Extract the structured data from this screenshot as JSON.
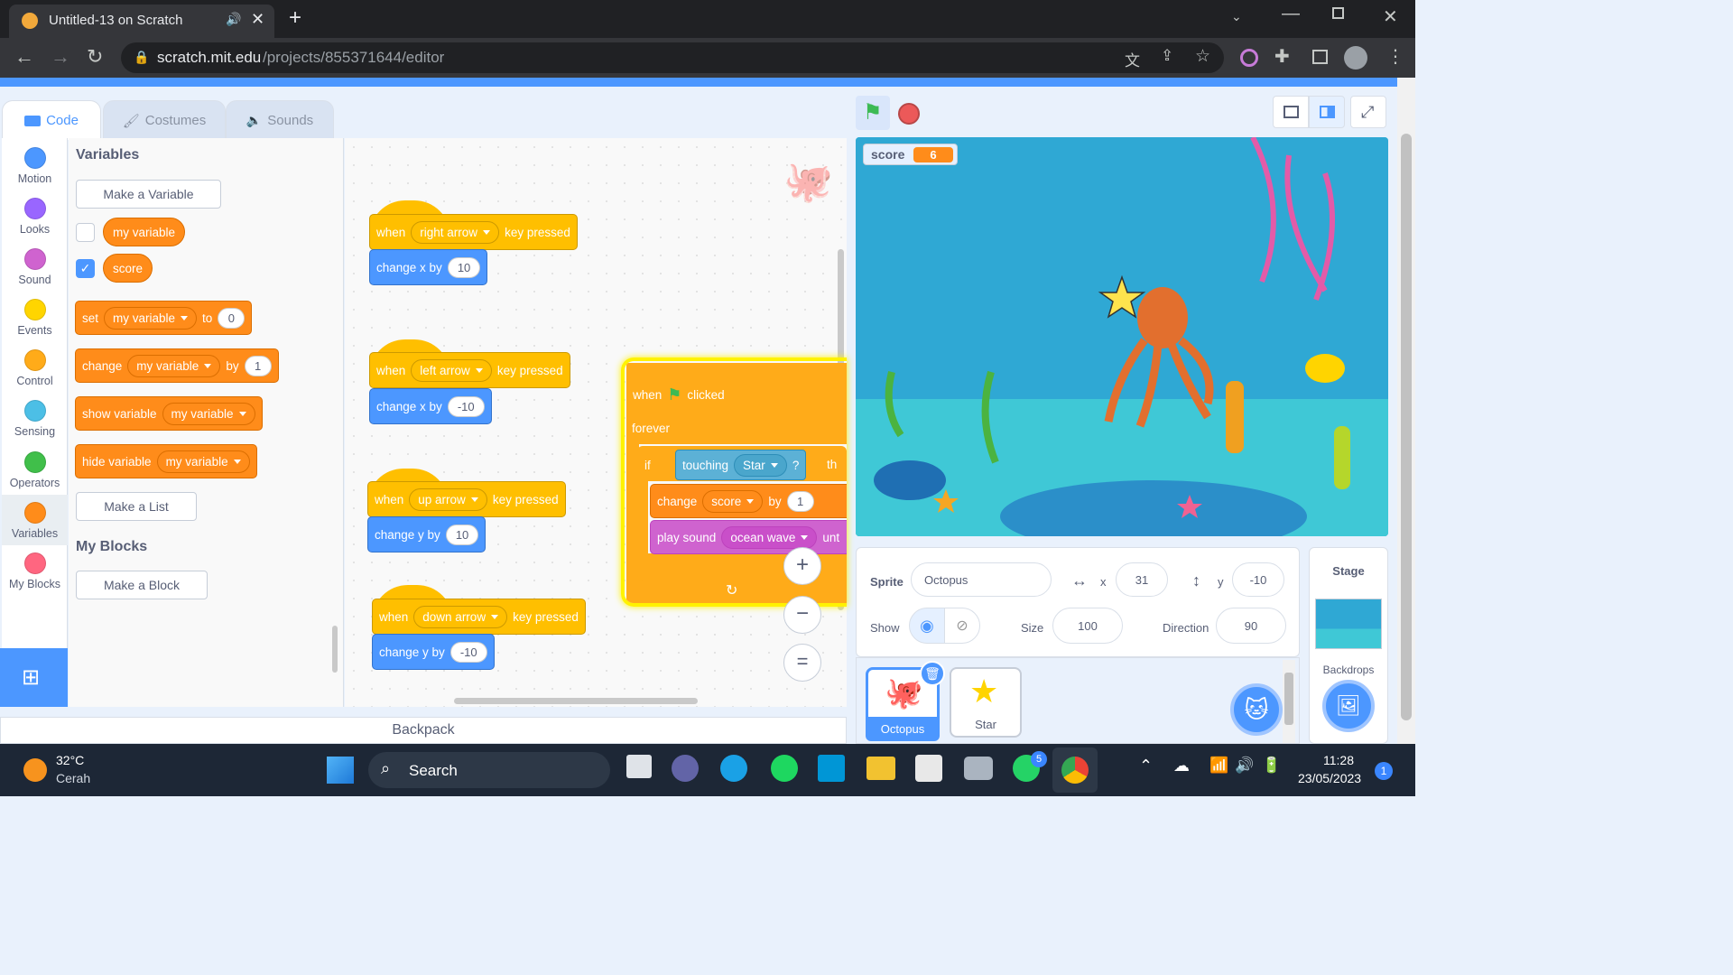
{
  "browser": {
    "tab_title": "Untitled-13 on Scratch",
    "url_host": "scratch.mit.edu",
    "url_path": "/projects/855371644/editor"
  },
  "editor": {
    "tabs": [
      {
        "label": "Code"
      },
      {
        "label": "Costumes"
      },
      {
        "label": "Sounds"
      }
    ],
    "categories": [
      {
        "label": "Motion",
        "color": "#4c97ff"
      },
      {
        "label": "Looks",
        "color": "#9966ff"
      },
      {
        "label": "Sound",
        "color": "#cf63cf"
      },
      {
        "label": "Events",
        "color": "#ffd500"
      },
      {
        "label": "Control",
        "color": "#ffab19"
      },
      {
        "label": "Sensing",
        "color": "#4cbfe6"
      },
      {
        "label": "Operators",
        "color": "#40bf4a"
      },
      {
        "label": "Variables",
        "color": "#ff8c1a"
      },
      {
        "label": "My Blocks",
        "color": "#ff6680"
      }
    ],
    "palette": {
      "variables_heading": "Variables",
      "make_variable": "Make a Variable",
      "vars": [
        "my variable",
        "score"
      ],
      "set": {
        "label": "set",
        "var": "my variable",
        "to": "to",
        "value": "0"
      },
      "change": {
        "label": "change",
        "var": "my variable",
        "by": "by",
        "value": "1"
      },
      "show": {
        "label": "show variable",
        "var": "my variable"
      },
      "hide": {
        "label": "hide variable",
        "var": "my variable"
      },
      "make_list": "Make a List",
      "myblocks_heading": "My Blocks",
      "make_block": "Make a Block"
    },
    "scripts": [
      {
        "when": "when",
        "key": "right arrow",
        "pressed": "key pressed",
        "action": "change x by",
        "value": "10"
      },
      {
        "when": "when",
        "key": "left arrow",
        "pressed": "key pressed",
        "action": "change x by",
        "value": "-10"
      },
      {
        "when": "when",
        "key": "up arrow",
        "pressed": "key pressed",
        "action": "change y by",
        "value": "10"
      },
      {
        "when": "when",
        "key": "down arrow",
        "pressed": "key pressed",
        "action": "change y by",
        "value": "-10"
      }
    ],
    "main_script": {
      "when": "when",
      "clicked": "clicked",
      "forever": "forever",
      "if": "if",
      "touching": "touching",
      "touch_target": "Star",
      "q": "?",
      "then": "th",
      "change": "change",
      "var": "score",
      "by": "by",
      "value": "1",
      "play": "play sound",
      "sound": "ocean wave",
      "until": "unt"
    },
    "zoom": {
      "in": "+",
      "out": "−",
      "reset": "="
    },
    "backpack": "Backpack"
  },
  "stage": {
    "monitor_label": "score",
    "monitor_value": "6"
  },
  "sprite_info": {
    "sprite_label": "Sprite",
    "sprite_name": "Octopus",
    "x_label": "x",
    "x": "31",
    "y_label": "y",
    "y": "-10",
    "show_label": "Show",
    "size_label": "Size",
    "size": "100",
    "direction_label": "Direction",
    "direction": "90"
  },
  "sprites": [
    {
      "name": "Octopus"
    },
    {
      "name": "Star"
    }
  ],
  "stage_panel": {
    "title": "Stage",
    "backdrops": "Backdrops"
  },
  "taskbar": {
    "temp": "32°C",
    "weather": "Cerah",
    "search": "Search",
    "time": "11:28",
    "date": "23/05/2023",
    "whatsapp_badge": "5",
    "notif": "1"
  }
}
